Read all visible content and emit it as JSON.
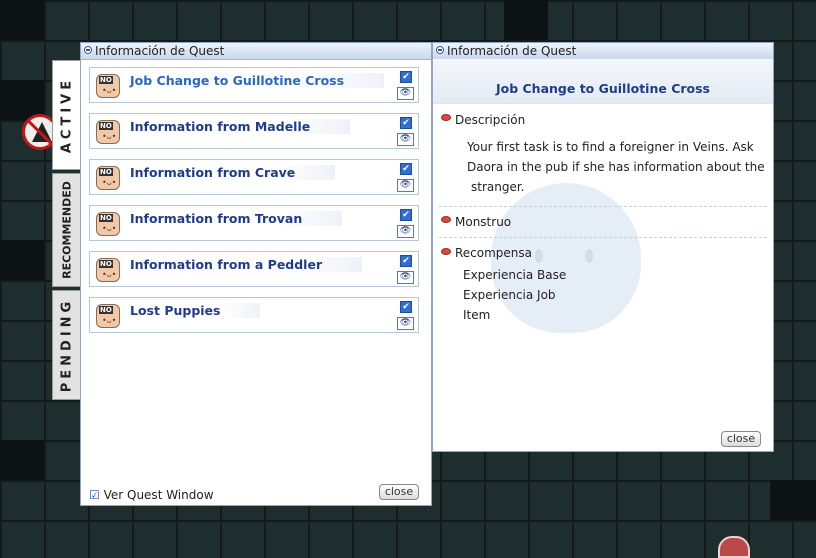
{
  "left_window": {
    "title": "Información de Quest",
    "tabs": [
      {
        "label": "ACTIVE"
      },
      {
        "label": "RECOMMENDED"
      },
      {
        "label": "PENDING"
      }
    ],
    "quests": [
      {
        "title": "Job Change to Guillotine Cross",
        "selected": true
      },
      {
        "title": "Information from Madelle"
      },
      {
        "title": "Information from Crave"
      },
      {
        "title": "Information from Trovan"
      },
      {
        "title": "Information from a Peddler"
      },
      {
        "title": "Lost Puppies"
      }
    ],
    "npc_badge": "NO",
    "npc_face": "•ᴗ•",
    "check_glyph": "✔",
    "eye_glyph": "👁",
    "footer": {
      "checkbox_label": "Ver Quest Window",
      "checkbox_glyph": "☑",
      "close_label": "close"
    }
  },
  "right_window": {
    "title": "Información de Quest",
    "quest_title": "Job Change to Guillotine Cross",
    "description_label": "Descripción",
    "description_lines": [
      "Your first task is to find a foreigner in Veins. Ask",
      "Daora in the pub if she has information about the",
      "stranger."
    ],
    "monster_label": "Monstruo",
    "reward_label": "Recompensa",
    "rewards": [
      "Experiencia Base",
      "Experiencia Job",
      "Item"
    ],
    "close_label": "close"
  },
  "colors": {
    "accent": "#1f3c8c",
    "selected": "#2a66c8",
    "bullet": "#d94a3a"
  }
}
